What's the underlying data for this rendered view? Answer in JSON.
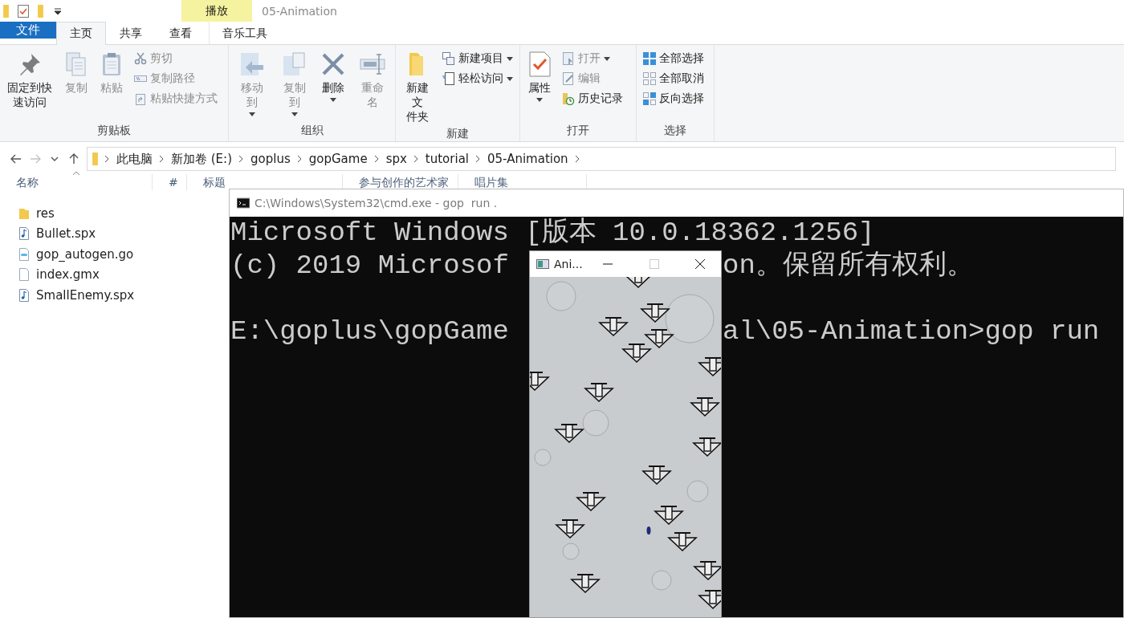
{
  "explorer": {
    "contextual_group": "播放",
    "window_title": "05-Animation",
    "tabs": [
      {
        "label": "文件",
        "kind": "file",
        "selected": false
      },
      {
        "label": "主页",
        "kind": "normal",
        "selected": true
      },
      {
        "label": "共享",
        "kind": "normal",
        "selected": false
      },
      {
        "label": "查看",
        "kind": "normal",
        "selected": false
      },
      {
        "label": "音乐工具",
        "kind": "contextual",
        "selected": false
      }
    ],
    "ribbon": [
      {
        "label": "剪贴板",
        "items": [
          {
            "kind": "large",
            "label": "固定到快速访问",
            "disabled": false,
            "dropdown": false
          },
          {
            "kind": "large",
            "label": "复制",
            "disabled": true,
            "dropdown": false
          },
          {
            "kind": "large",
            "label": "粘贴",
            "disabled": true,
            "dropdown": false
          },
          {
            "kind": "small",
            "label": "剪切",
            "disabled": true,
            "dropdown": false
          },
          {
            "kind": "small",
            "label": "复制路径",
            "disabled": true,
            "dropdown": false
          },
          {
            "kind": "small",
            "label": "粘贴快捷方式",
            "disabled": true,
            "dropdown": false
          }
        ]
      },
      {
        "label": "组织",
        "items": [
          {
            "kind": "large",
            "label": "移动到",
            "disabled": true,
            "dropdown": true
          },
          {
            "kind": "large",
            "label": "复制到",
            "disabled": true,
            "dropdown": true
          },
          {
            "kind": "large",
            "label": "删除",
            "disabled": false,
            "dropdown": true
          },
          {
            "kind": "large",
            "label": "重命名",
            "disabled": true,
            "dropdown": false
          }
        ]
      },
      {
        "label": "新建",
        "items": [
          {
            "kind": "large",
            "label": "新建文件夹",
            "disabled": false,
            "dropdown": false
          },
          {
            "kind": "small",
            "label": "新建项目",
            "disabled": false,
            "dropdown": true
          },
          {
            "kind": "small",
            "label": "轻松访问",
            "disabled": false,
            "dropdown": true
          }
        ]
      },
      {
        "label": "打开",
        "items": [
          {
            "kind": "large",
            "label": "属性",
            "disabled": false,
            "dropdown": true
          },
          {
            "kind": "small",
            "label": "打开",
            "disabled": true,
            "dropdown": true
          },
          {
            "kind": "small",
            "label": "编辑",
            "disabled": true,
            "dropdown": false
          },
          {
            "kind": "small",
            "label": "历史记录",
            "disabled": false,
            "dropdown": false
          }
        ]
      },
      {
        "label": "选择",
        "items": [
          {
            "kind": "small",
            "label": "全部选择",
            "disabled": false,
            "dropdown": false
          },
          {
            "kind": "small",
            "label": "全部取消",
            "disabled": false,
            "dropdown": false
          },
          {
            "kind": "small",
            "label": "反向选择",
            "disabled": false,
            "dropdown": false
          }
        ]
      }
    ],
    "nav": [
      {
        "kind": "back",
        "disabled": false
      },
      {
        "kind": "forward",
        "disabled": true
      },
      {
        "kind": "recent",
        "disabled": false
      },
      {
        "kind": "up",
        "disabled": false
      }
    ],
    "breadcrumbs": [
      "此电脑",
      "新加卷 (E:)",
      "goplus",
      "gopGame",
      "spx",
      "tutorial",
      "05-Animation"
    ],
    "columns": [
      {
        "label": "名称",
        "sorted": true
      },
      {
        "label": "#",
        "sorted": false
      },
      {
        "label": "标题",
        "sorted": false
      },
      {
        "label": "参与创作的艺术家",
        "sorted": false
      },
      {
        "label": "唱片集",
        "sorted": false
      }
    ],
    "files": [
      {
        "name": "res",
        "kind": "folder"
      },
      {
        "name": "Bullet.spx",
        "kind": "audio"
      },
      {
        "name": "gop_autogen.go",
        "kind": "go"
      },
      {
        "name": "index.gmx",
        "kind": "file"
      },
      {
        "name": "SmallEnemy.spx",
        "kind": "audio"
      }
    ]
  },
  "cmd": {
    "title": "C:\\Windows\\System32\\cmd.exe - gop  run .",
    "lines": [
      {
        "kind": "text",
        "left": "Microsoft Windows [版本 10.0.18362.1256]"
      },
      {
        "kind": "text",
        "left": "(c) 2019 Microsof",
        "right": "on。保留所有权利。"
      },
      {
        "kind": "blank"
      },
      {
        "kind": "text",
        "left": "E:\\goplus\\gopGame",
        "right": "al\\05-Animation>gop run"
      }
    ]
  },
  "game": {
    "title": "Ani...",
    "maximize_disabled": true
  }
}
